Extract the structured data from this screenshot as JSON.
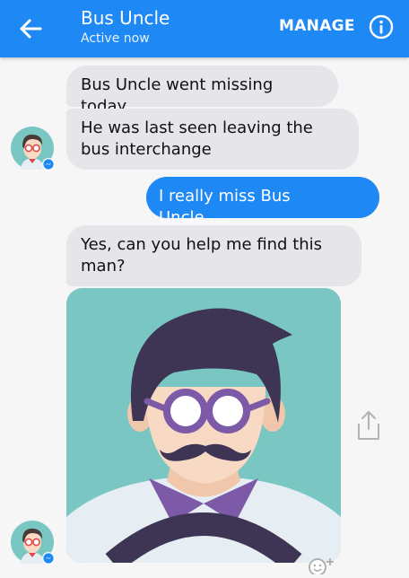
{
  "header": {
    "title": "Bus Uncle",
    "status": "Active now",
    "manage_label": "MANAGE"
  },
  "messages": [
    {
      "sender": "them",
      "text": "Bus Uncle went missing today"
    },
    {
      "sender": "them",
      "text": "He was last seen leaving the bus interchange"
    },
    {
      "sender": "me",
      "text": "I really miss Bus Uncle....."
    },
    {
      "sender": "them",
      "text": "Yes, can you help me find this man?"
    }
  ],
  "icons": {
    "back": "arrow-left-icon",
    "info": "info-circle-icon",
    "share": "share-upload-icon",
    "reaction": "add-reaction-icon",
    "messenger_badge": "messenger-badge-icon"
  },
  "colors": {
    "header_blue": "#1e88f5",
    "bubble_incoming": "#e5e5ea",
    "bubble_outgoing": "#1e88f5",
    "photo_background": "#79c6c3"
  }
}
